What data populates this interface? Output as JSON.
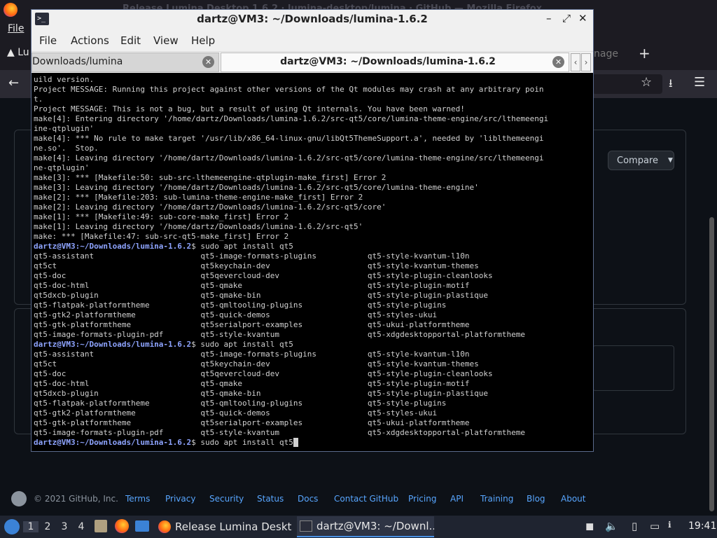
{
  "firefox": {
    "window_title": "Release Lumina Desktop 1.6.2 · lumina-desktop/lumina · GitHub — Mozilla Firefox",
    "menu_file": "File",
    "tab_fragment": "Lu",
    "tab_fragment_right": "nage",
    "new_tab": "+",
    "back": "←",
    "bookmark": "☆",
    "download": "⭳",
    "menu": "☰"
  },
  "github": {
    "compare_label": "Compare",
    "footer_copy": "© 2021 GitHub, Inc.",
    "footer_links": [
      "Terms",
      "Privacy",
      "Security",
      "Status",
      "Docs",
      "Contact GitHub",
      "Pricing",
      "API",
      "Training",
      "Blog",
      "About"
    ]
  },
  "terminal": {
    "title": "dartz@VM3: ~/Downloads/lumina-1.6.2",
    "menus": [
      "File",
      "Actions",
      "Edit",
      "View",
      "Help"
    ],
    "tabs": [
      {
        "label": "Downloads/lumina"
      },
      {
        "label": "dartz@VM3: ~/Downloads/lumina-1.6.2"
      }
    ],
    "win_buttons": {
      "minimize": "–",
      "maximize": "⤢",
      "restore": "◆",
      "close": "✕"
    },
    "prompt": "dartz@VM3:~/Downloads/lumina-1.6.2",
    "output_lines": [
      "uild version.",
      "Project MESSAGE: Running this project against other versions of the Qt modules may crash at any arbitrary poin",
      "t.",
      "Project MESSAGE: This is not a bug, but a result of using Qt internals. You have been warned!",
      "make[4]: Entering directory '/home/dartz/Downloads/lumina-1.6.2/src-qt5/core/lumina-theme-engine/src/lthemeengi",
      "ine-qtplugin'",
      "make[4]: *** No rule to make target '/usr/lib/x86_64-linux-gnu/libQt5ThemeSupport.a', needed by 'liblthemeengi",
      "ne.so'.  Stop.",
      "make[4]: Leaving directory '/home/dartz/Downloads/lumina-1.6.2/src-qt5/core/lumina-theme-engine/src/lthemeengi",
      "ne-qtplugin'",
      "make[3]: *** [Makefile:50: sub-src-lthemeengine-qtplugin-make_first] Error 2",
      "make[3]: Leaving directory '/home/dartz/Downloads/lumina-1.6.2/src-qt5/core/lumina-theme-engine'",
      "make[2]: *** [Makefile:203: sub-lumina-theme-engine-make_first] Error 2",
      "make[2]: Leaving directory '/home/dartz/Downloads/lumina-1.6.2/src-qt5/core'",
      "make[1]: *** [Makefile:49: sub-core-make_first] Error 2",
      "make[1]: Leaving directory '/home/dartz/Downloads/lumina-1.6.2/src-qt5'",
      "make: *** [Makefile:47: sub-src-qt5-make_first] Error 2"
    ],
    "command": "$ sudo apt install qt5",
    "completions": [
      [
        "qt5-assistant",
        "qt5-image-formats-plugins",
        "qt5-style-kvantum-l10n"
      ],
      [
        "qt5ct",
        "qt5keychain-dev",
        "qt5-style-kvantum-themes"
      ],
      [
        "qt5-doc",
        "qt5qevercloud-dev",
        "qt5-style-plugin-cleanlooks"
      ],
      [
        "qt5-doc-html",
        "qt5-qmake",
        "qt5-style-plugin-motif"
      ],
      [
        "qt5dxcb-plugin",
        "qt5-qmake-bin",
        "qt5-style-plugin-plastique"
      ],
      [
        "qt5-flatpak-platformtheme",
        "qt5-qmltooling-plugins",
        "qt5-style-plugins"
      ],
      [
        "qt5-gtk2-platformtheme",
        "qt5-quick-demos",
        "qt5-styles-ukui"
      ],
      [
        "qt5-gtk-platformtheme",
        "qt5serialport-examples",
        "qt5-ukui-platformtheme"
      ],
      [
        "qt5-image-formats-plugin-pdf",
        "qt5-style-kvantum",
        "qt5-xdgdesktopportal-platformtheme"
      ]
    ]
  },
  "taskbar": {
    "workspaces": [
      "1",
      "2",
      "3",
      "4"
    ],
    "task1_label": "Release Lumina Deskt...",
    "task2_label": "dartz@VM3: ~/Downl...",
    "clock": "19:41",
    "tray_icons": [
      "monitor-icon",
      "volume-icon",
      "clipboard-icon",
      "network-icon",
      "notification-icon"
    ]
  },
  "colors": {
    "prompt": "#8ea4ff",
    "terminal_bg": "#000000",
    "github_bg": "#0d1117",
    "link": "#58a6ff"
  }
}
